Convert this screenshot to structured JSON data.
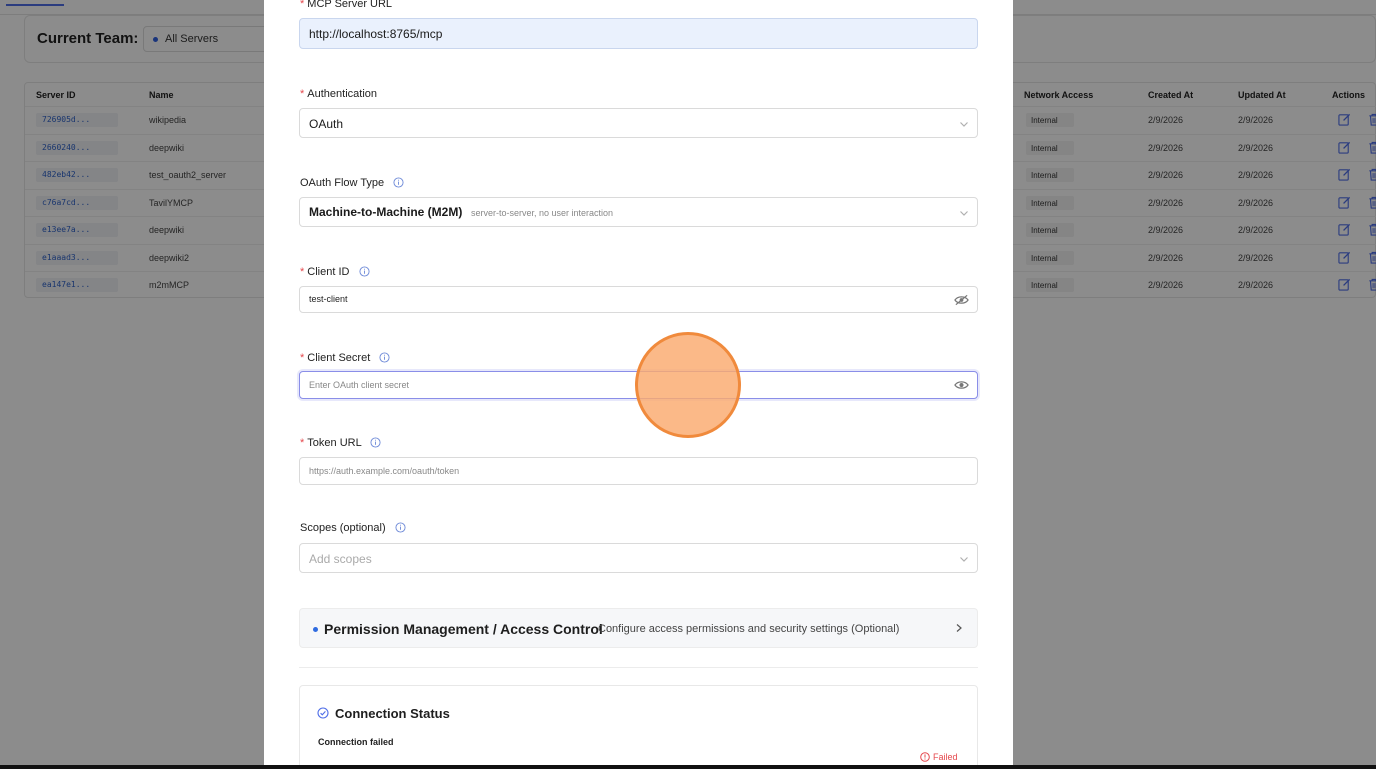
{
  "background": {
    "team_label": "Current Team:",
    "team_select_value": "All Servers",
    "columns": {
      "server_id": "Server ID",
      "name": "Name",
      "network_access": "Network Access",
      "created_at": "Created At",
      "updated_at": "Updated At",
      "actions": "Actions"
    },
    "rows": [
      {
        "id": "726905d...",
        "name": "wikipedia",
        "network": "Internal",
        "created": "2/9/2026",
        "updated": "2/9/2026"
      },
      {
        "id": "2660240...",
        "name": "deepwiki",
        "network": "Internal",
        "created": "2/9/2026",
        "updated": "2/9/2026"
      },
      {
        "id": "482eb42...",
        "name": "test_oauth2_server",
        "network": "Internal",
        "created": "2/9/2026",
        "updated": "2/9/2026"
      },
      {
        "id": "c76a7cd...",
        "name": "TavilYMCP",
        "network": "Internal",
        "created": "2/9/2026",
        "updated": "2/9/2026"
      },
      {
        "id": "e13ee7a...",
        "name": "deepwiki",
        "network": "Internal",
        "created": "2/9/2026",
        "updated": "2/9/2026"
      },
      {
        "id": "e1aaad3...",
        "name": "deepwiki2",
        "network": "Internal",
        "created": "2/9/2026",
        "updated": "2/9/2026"
      },
      {
        "id": "ea147e1...",
        "name": "m2mMCP",
        "network": "Internal",
        "created": "2/9/2026",
        "updated": "2/9/2026"
      }
    ]
  },
  "modal": {
    "mcp_url": {
      "label": "MCP Server URL",
      "value": "http://localhost:8765/mcp"
    },
    "authentication": {
      "label": "Authentication",
      "value": "OAuth"
    },
    "oauth_flow": {
      "label": "OAuth Flow Type",
      "value": "Machine-to-Machine (M2M)",
      "hint": "server-to-server, no user interaction"
    },
    "client_id": {
      "label": "Client ID",
      "value": "test-client"
    },
    "client_secret": {
      "label": "Client Secret",
      "placeholder": "Enter OAuth client secret"
    },
    "token_url": {
      "label": "Token URL",
      "placeholder": "https://auth.example.com/oauth/token"
    },
    "scopes": {
      "label": "Scopes (optional)",
      "placeholder": "Add scopes"
    },
    "permissions": {
      "title": "Permission Management / Access Control",
      "subtitle": "Configure access permissions and security settings (Optional)"
    },
    "connection": {
      "title": "Connection Status",
      "message": "Connection failed",
      "status": "Failed"
    }
  },
  "icons": {
    "info": "info-circle-icon",
    "chevron_down": "chevron-down-icon",
    "chevron_right": "chevron-right-icon",
    "eye": "eye-icon",
    "eye_off": "eye-off-icon",
    "edit": "edit-icon",
    "delete": "trash-icon",
    "check_circle": "check-circle-icon",
    "alert_circle": "alert-circle-icon"
  },
  "colors": {
    "accent": "#4f6ee8",
    "error": "#e5484d",
    "focus_border": "#8a8ee8",
    "cursor_fill": "#faaa6e",
    "cursor_border": "#f08a3c"
  }
}
